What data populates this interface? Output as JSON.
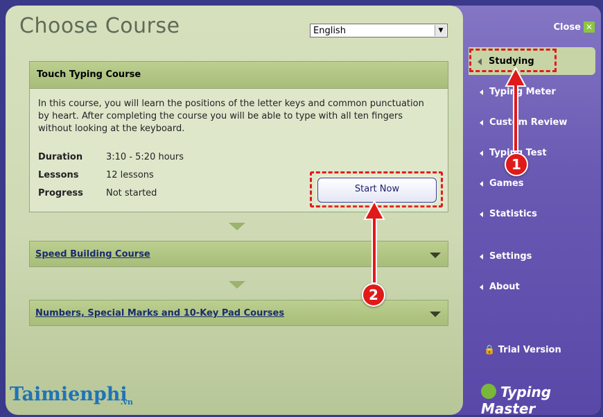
{
  "header": {
    "title": "Choose Course",
    "language": "English"
  },
  "course1": {
    "title": "Touch Typing Course",
    "description": "In this course, you will learn the positions of the letter keys and common punctuation by heart. After completing the course you will be able to type with all ten fingers without looking at the keyboard.",
    "details": [
      {
        "label": "Duration",
        "value": "3:10 - 5:20 hours"
      },
      {
        "label": "Lessons",
        "value": "12 lessons"
      },
      {
        "label": "Progress",
        "value": "Not started"
      }
    ],
    "button": "Start Now"
  },
  "course2": {
    "title": "Speed Building Course"
  },
  "course3": {
    "title": "Numbers, Special Marks and 10-Key Pad Courses"
  },
  "sidebar": {
    "close": "Close",
    "active": "Studying",
    "items": [
      "Typing Meter",
      "Custom Review",
      "Typing Test",
      "Games",
      "Statistics",
      "Settings",
      "About"
    ],
    "trial": "Trial Version",
    "brand": "Typing Master"
  },
  "watermark": {
    "name": "Taimienphi",
    "suffix": ".vn"
  },
  "annotations": [
    "1",
    "2"
  ],
  "colors": {
    "sidebar": "#6a5ab3",
    "panel_header": "#a7bd79",
    "highlight": "#e01a1a"
  }
}
